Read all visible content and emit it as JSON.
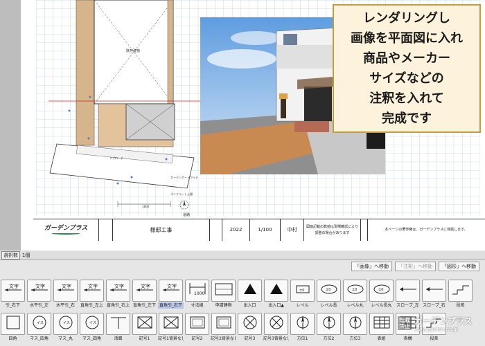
{
  "note": {
    "lines": [
      "レンダリングし",
      "画像を平面図に入れ",
      "商品やメーカー",
      "サイズなどの",
      "注釈を入れて",
      "完成です"
    ]
  },
  "plan": {
    "north_label": "N",
    "labels": {
      "building": "既存建物",
      "car": "ガーデンポートワイド",
      "concrete": "コンクリート土間",
      "approach": "アプローチ",
      "road": "道路",
      "dim": "1800",
      "entrance": "玄関",
      "border": "隣地境界"
    }
  },
  "title_block": {
    "logo": "ガーデンプラス",
    "project": "様邸工事",
    "year": "2022",
    "scale": "1/100",
    "person": "中村",
    "note1": "図面記載の数値は現場確認により調整の場合があります",
    "note2": "本ページの著作権は、ガーデンプラスに帰属します。"
  },
  "selection": {
    "tag": "選択数",
    "count": "1個"
  },
  "modes": [
    {
      "label": "「画像」へ移動",
      "enabled": true
    },
    {
      "label": "「注釈」へ移動",
      "enabled": false
    },
    {
      "label": "「図形」へ移動",
      "enabled": true
    }
  ],
  "palette_row1": [
    {
      "label": "引_右下",
      "icon": "text-leader-right-down-icon"
    },
    {
      "label": "水平引_左",
      "icon": "text-leader-left-icon"
    },
    {
      "label": "水平引_右",
      "icon": "text-leader-right-icon"
    },
    {
      "label": "直角引_左上",
      "icon": "text-angle-left-up-icon"
    },
    {
      "label": "直角引_右上",
      "icon": "text-angle-right-up-icon"
    },
    {
      "label": "直角引_左下",
      "icon": "text-angle-left-down-icon"
    },
    {
      "label": "直角引_右下",
      "icon": "text-angle-right-down-icon",
      "highlight": true
    },
    {
      "label": "寸法線",
      "icon": "dimension-icon"
    },
    {
      "label": "申請建物",
      "icon": "building-note-icon"
    },
    {
      "label": "出入口",
      "icon": "entrance-triangle-icon"
    },
    {
      "label": "出入口▲",
      "icon": "entrance-triangle-small-icon"
    },
    {
      "label": "レベル",
      "icon": "level-rect-icon"
    },
    {
      "label": "レベル長",
      "icon": "level-ellipse-icon"
    },
    {
      "label": "レベル丸",
      "icon": "level-oval-icon"
    },
    {
      "label": "レベル長丸",
      "icon": "level-long-oval-icon"
    },
    {
      "label": "スロープ_左",
      "icon": "slope-left-icon"
    },
    {
      "label": "スロープ_右",
      "icon": "slope-right-icon"
    },
    {
      "label": "段差",
      "icon": "step-icon"
    }
  ],
  "palette_row2": [
    {
      "label": "四角",
      "icon": "square-icon"
    },
    {
      "label": "マス_四角",
      "icon": "mass-square-icon"
    },
    {
      "label": "マス_丸",
      "icon": "mass-circle-icon"
    },
    {
      "label": "マス_四角",
      "icon": "mass-square-icon-2"
    },
    {
      "label": "活面",
      "icon": "section-icon"
    },
    {
      "label": "記号1",
      "icon": "box-cross-icon"
    },
    {
      "label": "記号1背景なし",
      "icon": "box-cross-open-icon"
    },
    {
      "label": "記号2",
      "icon": "box-plain-icon"
    },
    {
      "label": "記号2背景なし",
      "icon": "box-plain-open-icon"
    },
    {
      "label": "記号3",
      "icon": "circle-cross-icon"
    },
    {
      "label": "記号3背景なし",
      "icon": "circle-cross-open-icon"
    },
    {
      "label": "方位1",
      "icon": "compass-icon"
    },
    {
      "label": "方位2",
      "icon": "compass-arrow-icon"
    },
    {
      "label": "方位3",
      "icon": "compass-circle-icon"
    },
    {
      "label": "表組",
      "icon": "table-icon"
    },
    {
      "label": "表構",
      "icon": "table-alt-icon"
    },
    {
      "label": "段差",
      "icon": "step-alt-icon"
    }
  ],
  "watermark": {
    "kanji": "転載禁止",
    "brand": "ガーデンプラス",
    "url": "www.garden.ne.jp"
  },
  "colors": {
    "accent_orange": "#c79a3c",
    "note_bg": "#fdf3dc",
    "plan_ground": "#d6b48c",
    "render_sky": "#8fb8e6",
    "selection_highlight": "#b7c7e8"
  }
}
